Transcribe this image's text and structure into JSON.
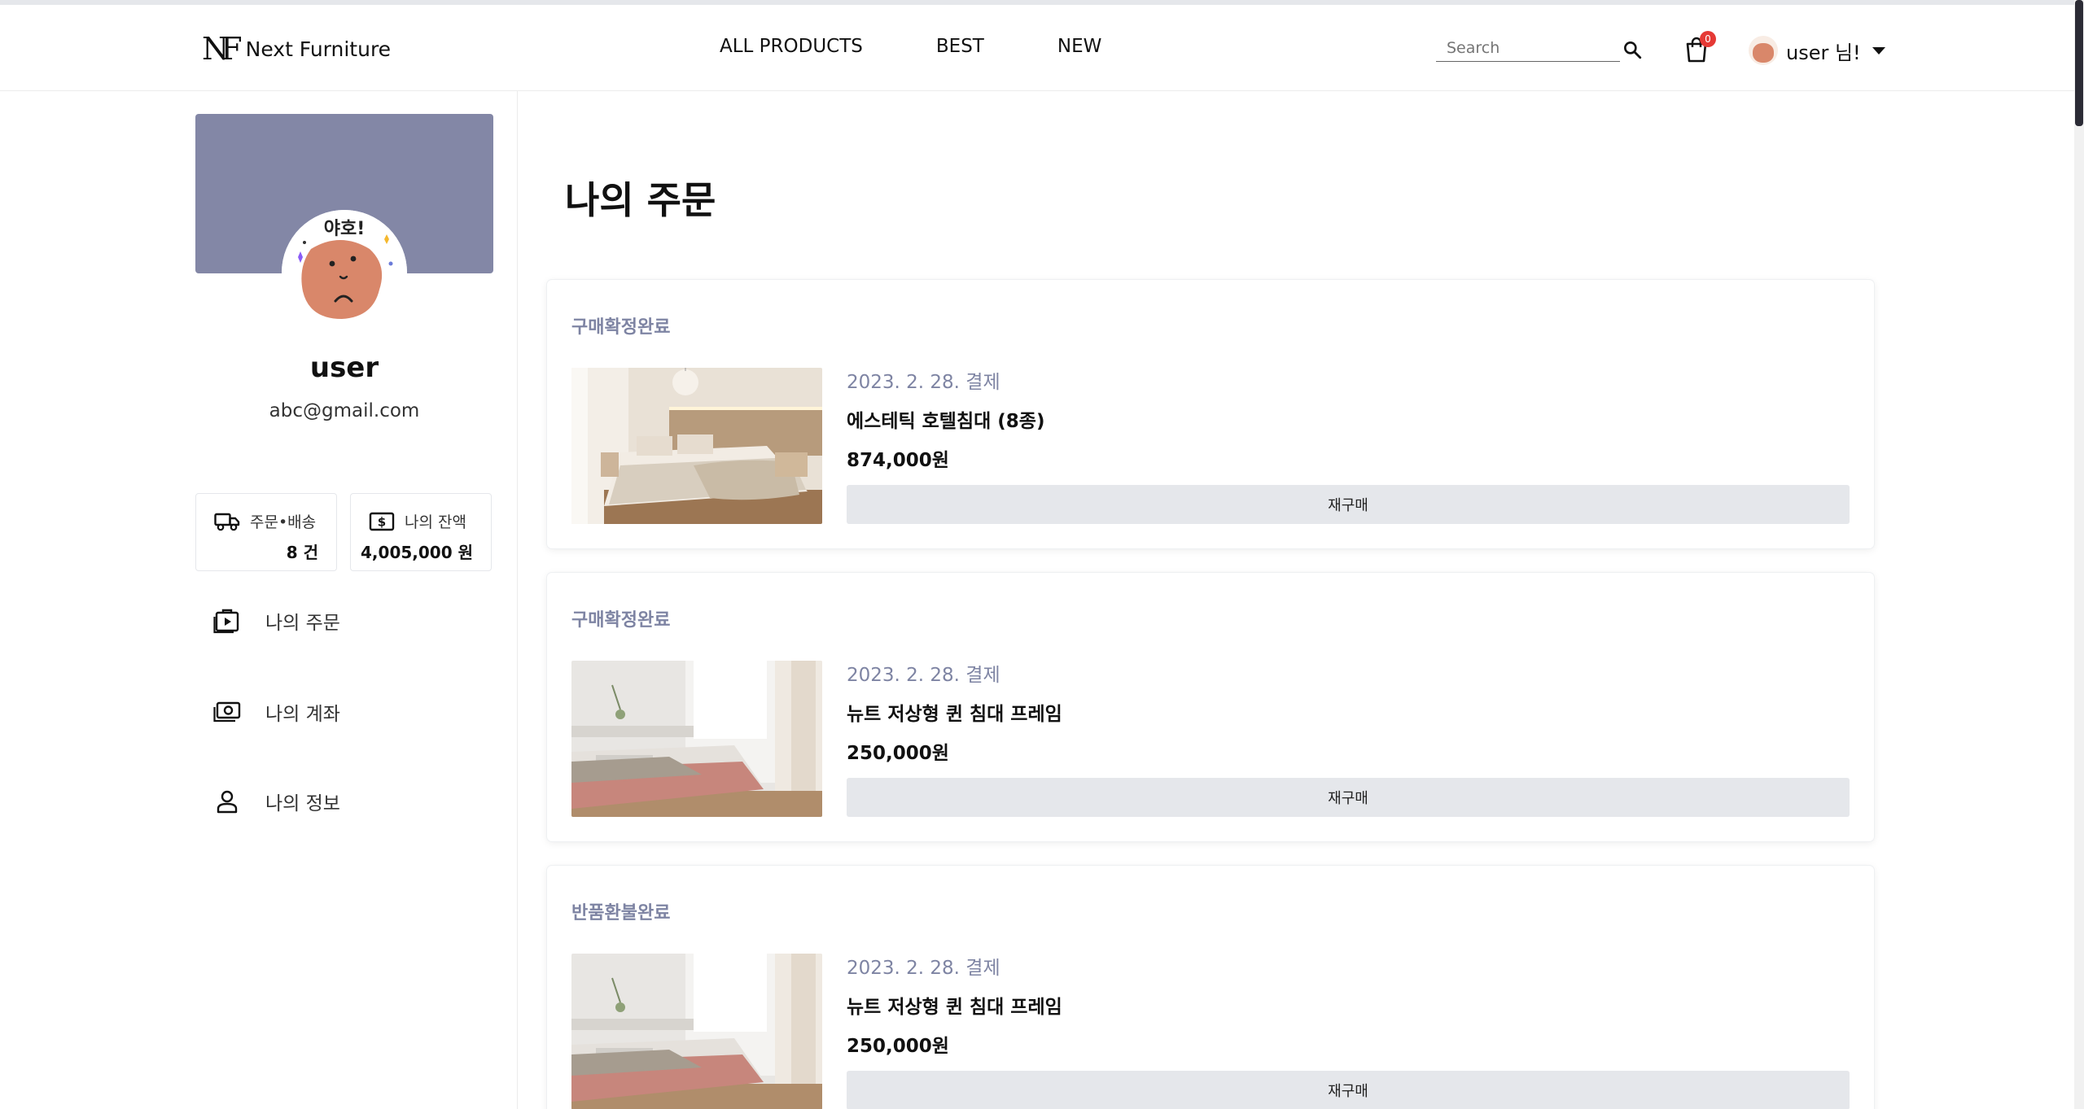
{
  "header": {
    "logo_mark": "NF",
    "logo_text": "Next Furniture",
    "nav": [
      "ALL PRODUCTS",
      "BEST",
      "NEW"
    ],
    "search_placeholder": "Search",
    "cart_count": "0",
    "user_label": "user 님!"
  },
  "sidebar": {
    "name": "user",
    "email": "abc@gmail.com",
    "stats": [
      {
        "label": "주문•배송",
        "value": "8 건",
        "icon": "truck-icon"
      },
      {
        "label": "나의 잔액",
        "value": "4,005,000 원",
        "icon": "dollar-bill-icon"
      }
    ],
    "menu": [
      {
        "label": "나의 주문",
        "icon": "play-briefcase-icon"
      },
      {
        "label": "나의 계좌",
        "icon": "money-icon"
      },
      {
        "label": "나의 정보",
        "icon": "person-icon"
      }
    ]
  },
  "main": {
    "title": "나의 주문",
    "orders": [
      {
        "status": "구매확정완료",
        "date": "2023. 2. 28. 결제",
        "name": "에스테틱 호텔침대 (8종)",
        "price": "874,000원",
        "button": "재구매"
      },
      {
        "status": "구매확정완료",
        "date": "2023. 2. 28. 결제",
        "name": "뉴트 저상형 퀸 침대 프레임",
        "price": "250,000원",
        "button": "재구매"
      },
      {
        "status": "반품환불완료",
        "date": "2023. 2. 28. 결제",
        "name": "뉴트 저상형 퀸 침대 프레임",
        "price": "250,000원",
        "button": "재구매"
      }
    ]
  },
  "colors": {
    "banner": "#8387a6",
    "status_text": "#7e84a3",
    "badge": "#e53935",
    "button_bg": "#e5e7eb"
  }
}
